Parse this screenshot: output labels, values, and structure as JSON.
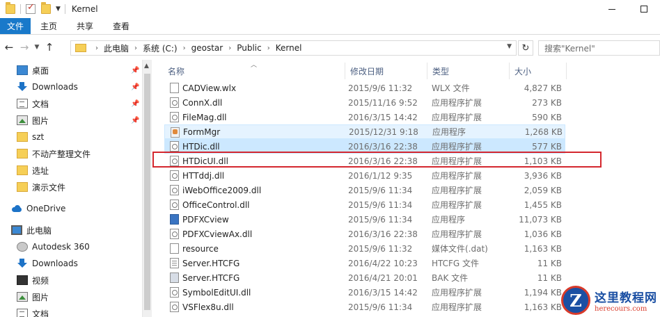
{
  "window": {
    "title": "Kernel"
  },
  "ribbon": {
    "tabs": [
      "文件",
      "主页",
      "共享",
      "查看"
    ]
  },
  "address": {
    "crumbs": [
      "此电脑",
      "系统 (C:)",
      "geostar",
      "Public",
      "Kernel"
    ],
    "search_placeholder": "搜索\"Kernel\""
  },
  "nav": {
    "items": [
      {
        "label": "桌面",
        "icon": "desktop-icon",
        "pinned": true
      },
      {
        "label": "Downloads",
        "icon": "download-icon",
        "pinned": true
      },
      {
        "label": "文档",
        "icon": "document-icon",
        "pinned": true
      },
      {
        "label": "图片",
        "icon": "picture-icon",
        "pinned": true
      },
      {
        "label": "szt",
        "icon": "folder-icon",
        "pinned": false
      },
      {
        "label": "不动产整理文件",
        "icon": "folder-icon",
        "pinned": false
      },
      {
        "label": "选址",
        "icon": "folder-icon",
        "pinned": false
      },
      {
        "label": "演示文件",
        "icon": "folder-icon",
        "pinned": false
      },
      {
        "label": "OneDrive",
        "icon": "cloud-icon",
        "pinned": false
      },
      {
        "label": "此电脑",
        "icon": "pc-icon",
        "pinned": false
      },
      {
        "label": "Autodesk 360",
        "icon": "autodesk-icon",
        "pinned": false
      },
      {
        "label": "Downloads",
        "icon": "download-icon",
        "pinned": false
      },
      {
        "label": "视频",
        "icon": "video-icon",
        "pinned": false
      },
      {
        "label": "图片",
        "icon": "picture-icon",
        "pinned": false
      },
      {
        "label": "文档",
        "icon": "document-icon",
        "pinned": false
      }
    ]
  },
  "columns": {
    "name": "名称",
    "date": "修改日期",
    "type": "类型",
    "size": "大小"
  },
  "files": [
    {
      "name": "CADView.wlx",
      "date": "2015/9/6 11:32",
      "type": "WLX 文件",
      "size": "4,827 KB",
      "icon": "file-icon"
    },
    {
      "name": "ConnX.dll",
      "date": "2015/11/16 9:52",
      "type": "应用程序扩展",
      "size": "273 KB",
      "icon": "dll-icon"
    },
    {
      "name": "FileMag.dll",
      "date": "2016/3/15 14:42",
      "type": "应用程序扩展",
      "size": "590 KB",
      "icon": "dll-icon"
    },
    {
      "name": "FormMgr",
      "date": "2015/12/31 9:18",
      "type": "应用程序",
      "size": "1,268 KB",
      "icon": "exe-icon"
    },
    {
      "name": "HTDic.dll",
      "date": "2016/3/16 22:38",
      "type": "应用程序扩展",
      "size": "577 KB",
      "icon": "dll-icon"
    },
    {
      "name": "HTDicUI.dll",
      "date": "2016/3/16 22:38",
      "type": "应用程序扩展",
      "size": "1,103 KB",
      "icon": "dll-icon"
    },
    {
      "name": "HTTddj.dll",
      "date": "2016/1/12 9:35",
      "type": "应用程序扩展",
      "size": "3,936 KB",
      "icon": "dll-icon"
    },
    {
      "name": "iWebOffice2009.dll",
      "date": "2015/9/6 11:34",
      "type": "应用程序扩展",
      "size": "2,059 KB",
      "icon": "dll-icon"
    },
    {
      "name": "OfficeControl.dll",
      "date": "2015/9/6 11:34",
      "type": "应用程序扩展",
      "size": "1,455 KB",
      "icon": "dll-icon"
    },
    {
      "name": "PDFXCview",
      "date": "2015/9/6 11:34",
      "type": "应用程序",
      "size": "11,073 KB",
      "icon": "pdf-exe-icon"
    },
    {
      "name": "PDFXCviewAx.dll",
      "date": "2016/3/16 22:38",
      "type": "应用程序扩展",
      "size": "1,036 KB",
      "icon": "dll-icon"
    },
    {
      "name": "resource",
      "date": "2015/9/6 11:32",
      "type": "媒体文件(.dat)",
      "size": "1,163 KB",
      "icon": "file-icon"
    },
    {
      "name": "Server.HTCFG",
      "date": "2016/4/22 10:23",
      "type": "HTCFG 文件",
      "size": "11 KB",
      "icon": "config-icon"
    },
    {
      "name": "Server.HTCFG",
      "date": "2016/4/21 20:01",
      "type": "BAK 文件",
      "size": "11 KB",
      "icon": "backup-icon"
    },
    {
      "name": "SymbolEditUI.dll",
      "date": "2016/3/15 14:42",
      "type": "应用程序扩展",
      "size": "1,194 KB",
      "icon": "dll-icon"
    },
    {
      "name": "VSFlex8u.dll",
      "date": "2015/9/6 11:34",
      "type": "应用程序扩展",
      "size": "1,163 KB",
      "icon": "dll-icon"
    }
  ],
  "watermark": {
    "letter": "Z",
    "title": "这里教程网",
    "sub": "herecours.com"
  }
}
